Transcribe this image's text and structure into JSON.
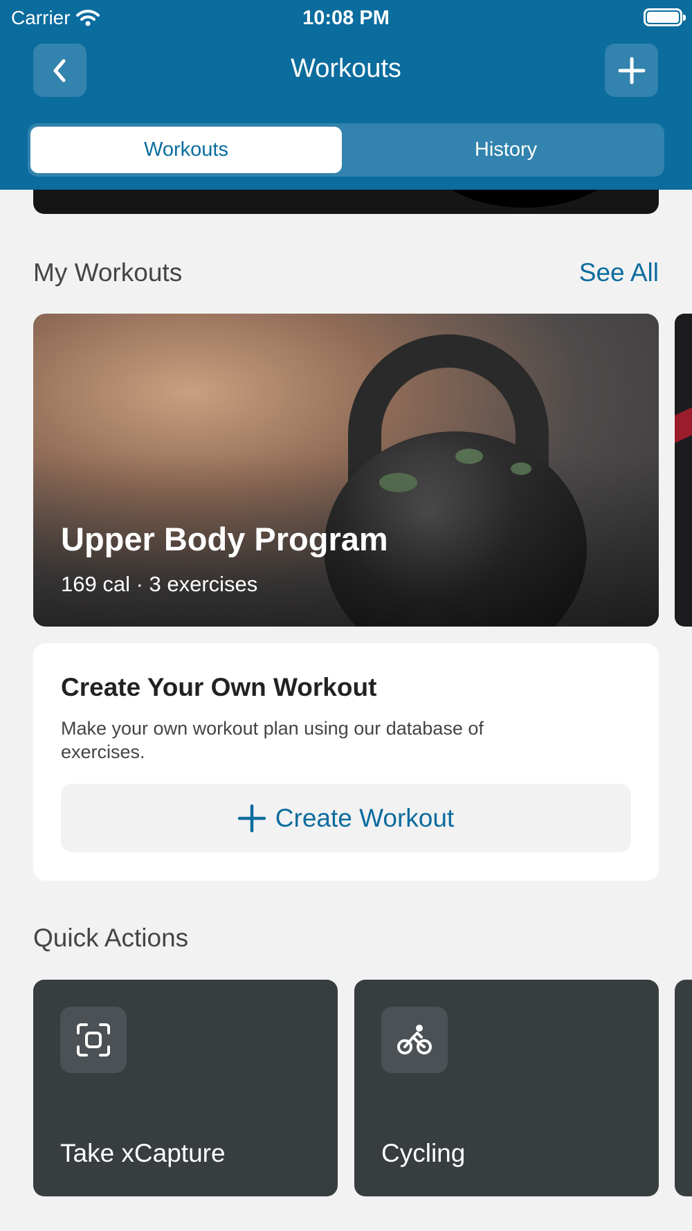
{
  "status_bar": {
    "carrier": "Carrier",
    "time": "10:08 PM"
  },
  "nav": {
    "title": "Workouts",
    "back_icon": "chevron-left-icon",
    "add_icon": "plus-icon"
  },
  "segments": {
    "active": "Workouts",
    "inactive": "History"
  },
  "my_workouts": {
    "title": "My Workouts",
    "see_all": "See All",
    "card": {
      "title": "Upper Body Program",
      "subtitle": "169 cal · 3 exercises"
    }
  },
  "create": {
    "title": "Create Your Own Workout",
    "description": "Make your own workout plan using our database of exercises.",
    "button": "Create Workout"
  },
  "quick_actions": {
    "title": "Quick Actions",
    "items": [
      {
        "label": "Take xCapture",
        "icon": "scan-icon"
      },
      {
        "label": "Cycling",
        "icon": "cycling-icon"
      }
    ]
  },
  "colors": {
    "brand": "#0b6c9e",
    "background": "#f2f2f2",
    "quick_action_card": "#383d40"
  }
}
